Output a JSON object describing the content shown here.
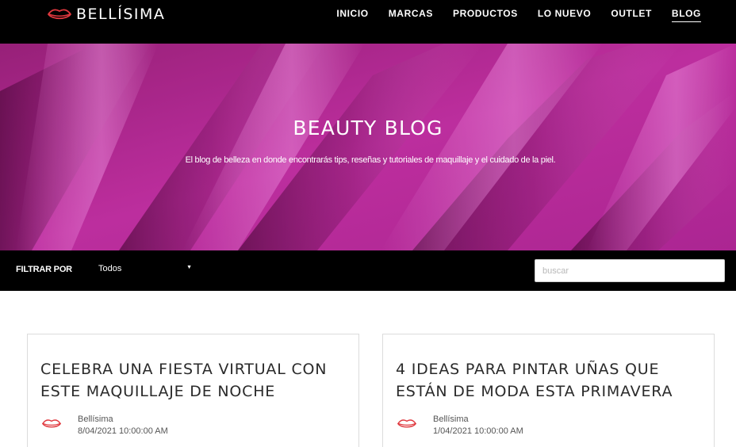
{
  "brand": {
    "name": "BELLÍSIMA",
    "logo_icon": "lips-icon",
    "accent_color": "#e0383e"
  },
  "nav": [
    {
      "label": "INICIO",
      "active": false
    },
    {
      "label": "MARCAS",
      "active": false
    },
    {
      "label": "PRODUCTOS",
      "active": false
    },
    {
      "label": "LO NUEVO",
      "active": false
    },
    {
      "label": "OUTLET",
      "active": false
    },
    {
      "label": "BLOG",
      "active": true
    }
  ],
  "hero": {
    "title": "BEAUTY BLOG",
    "subtitle": "El blog de belleza en donde encontrarás tips, reseñas y tutoriales de maquillaje y el cuidado de la piel.",
    "background_color": "#c02aa2"
  },
  "filter": {
    "label": "FILTRAR POR",
    "selected": "Todos",
    "search_placeholder": "buscar"
  },
  "posts": [
    {
      "title": "CELEBRA UNA FIESTA VIRTUAL CON ESTE MAQUILLAJE DE NOCHE",
      "author": "Bellísima",
      "date": "8/04/2021 10:00:00 AM"
    },
    {
      "title": "4 IDEAS PARA PINTAR UÑAS QUE ESTÁN DE MODA ESTA PRIMAVERA",
      "author": "Bellísima",
      "date": "1/04/2021 10:00:00 AM"
    }
  ]
}
